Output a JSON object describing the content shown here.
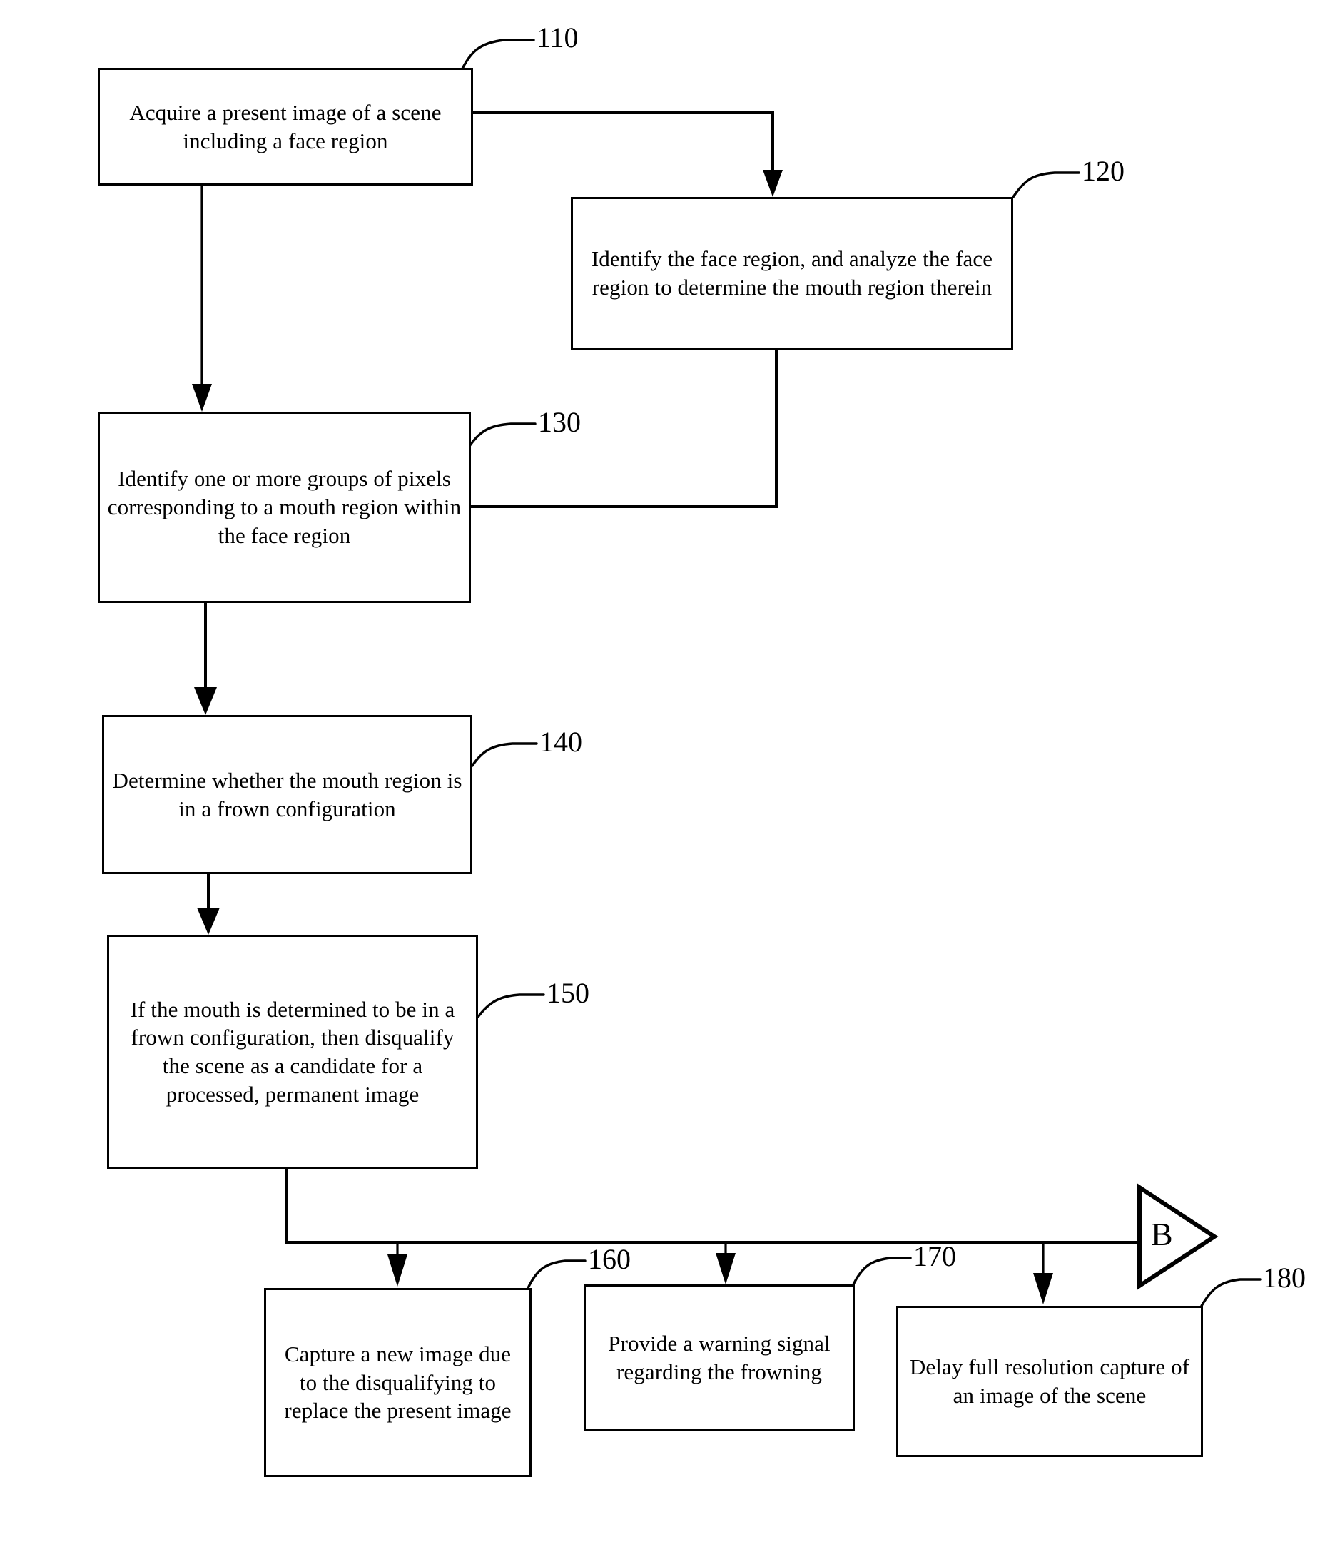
{
  "figure": {
    "type": "patent-flowchart",
    "boxes": [
      {
        "id": "110",
        "ref": "110",
        "text": "Acquire a present image of a scene including a face region"
      },
      {
        "id": "120",
        "ref": "120",
        "text": "Identify the face region, and analyze the face region to determine the mouth region therein"
      },
      {
        "id": "130",
        "ref": "130",
        "text": "Identify one or more groups of pixels corresponding to a mouth region within the face region"
      },
      {
        "id": "140",
        "ref": "140",
        "text": "Determine whether the mouth region is in a frown configuration"
      },
      {
        "id": "150",
        "ref": "150",
        "text": "If the mouth is determined to be in a frown configuration, then disqualify the scene as a candidate for a processed, permanent image"
      },
      {
        "id": "160",
        "ref": "160",
        "text": "Capture a new image due to the disqualifying to replace the present image"
      },
      {
        "id": "170",
        "ref": "170",
        "text": "Provide a warning signal regarding the frowning"
      },
      {
        "id": "180",
        "ref": "180",
        "text": "Delay full resolution capture of an image of the scene"
      }
    ],
    "connectors": {
      "off_page_label": "B"
    },
    "colors": {
      "line": "#000000",
      "text": "#000000",
      "background": "#ffffff"
    }
  }
}
